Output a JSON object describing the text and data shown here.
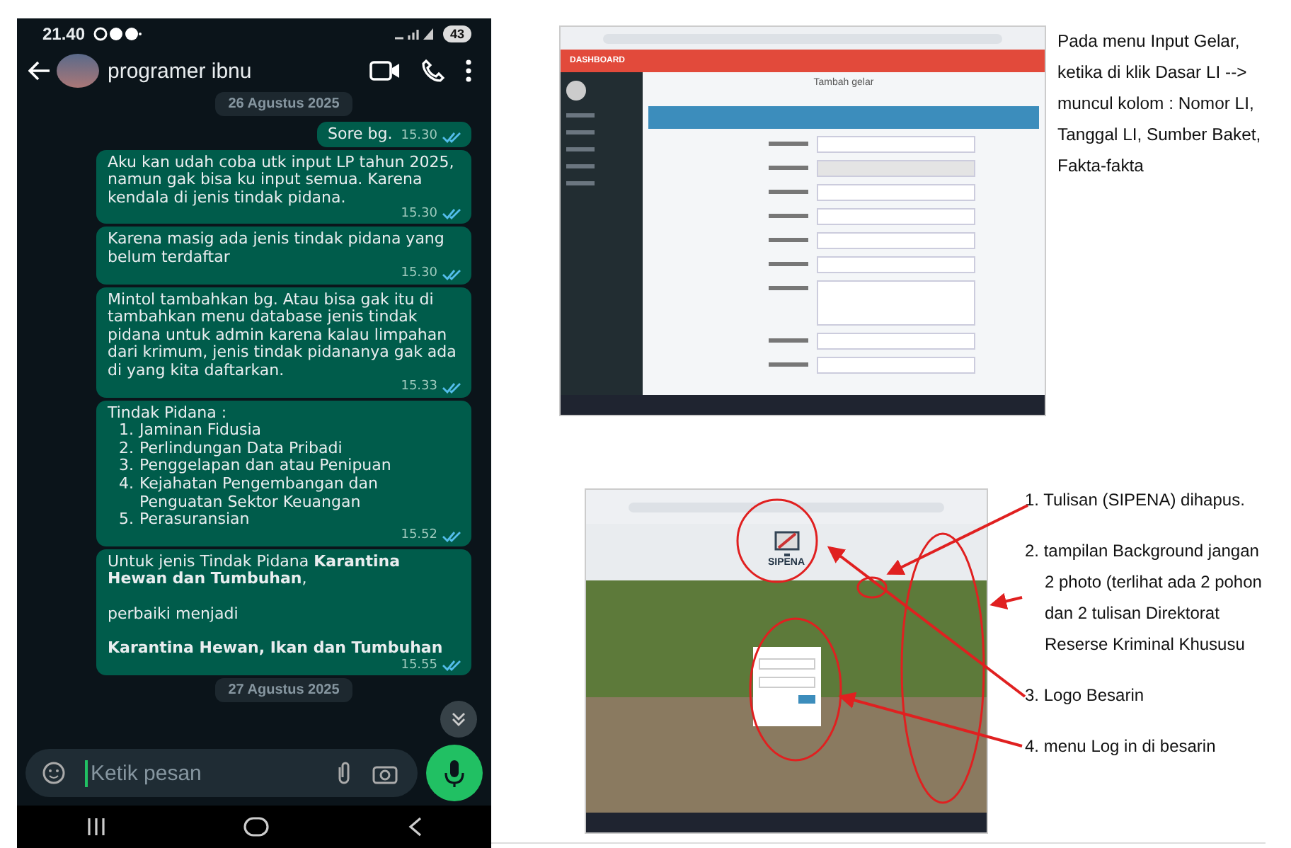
{
  "phone": {
    "status_bar": {
      "time": "21.40",
      "battery": "43"
    },
    "chat_header": {
      "contact_name": "programer ibnu"
    },
    "messages": [
      {
        "kind": "date",
        "text": "26 Agustus 2025"
      },
      {
        "kind": "text",
        "text": "Sore bg.",
        "time": "15.30",
        "read": true
      },
      {
        "kind": "text",
        "text": "Aku kan udah coba utk input LP tahun 2025, namun gak bisa ku input semua. Karena kendala di jenis tindak pidana.",
        "time": "15.30",
        "read": true
      },
      {
        "kind": "text",
        "text": "Karena masig ada jenis tindak pidana yang belum terdaftar",
        "time": "15.30",
        "read": true
      },
      {
        "kind": "text",
        "text": "Mintol tambahkan bg. Atau bisa gak itu di tambahkan menu database jenis tindak pidana untuk admin karena kalau limpahan dari krimum, jenis tindak pidananya gak ada di yang kita daftarkan.",
        "time": "15.33",
        "read": true
      },
      {
        "kind": "list",
        "heading": "Tindak Pidana :",
        "items": [
          {
            "number": "1.",
            "text": "Jaminan Fidusia"
          },
          {
            "number": "2.",
            "text": "Perlindungan Data Pribadi"
          },
          {
            "number": "3.",
            "text": "Penggelapan dan atau Penipuan"
          },
          {
            "number": "4.",
            "text": "Kejahatan Pengembangan dan Penguatan Sektor Keuangan"
          },
          {
            "number": "5.",
            "text": "Perasuransian"
          }
        ],
        "time": "15.52",
        "read": true
      },
      {
        "kind": "paragraphs",
        "paragraphs": [
          {
            "text": "Untuk jenis Tindak Pidana **Karantina Hewan dan Tumbuhan**,",
            "bold": false
          },
          {
            "text": "perbaiki menjadi",
            "bold": false
          },
          {
            "text": "Karantina Hewan, Ikan dan Tumbuhan",
            "bold": true
          }
        ],
        "time": "15.55",
        "read": true
      },
      {
        "kind": "date",
        "text": "27 Agustus 2025"
      }
    ],
    "composer": {
      "placeholder": "Ketik pesan"
    }
  },
  "document": {
    "screenshot_1": {
      "brand": "DASHBOARD",
      "page_title": "Tambah gelar",
      "caption": "Pada menu Input Gelar, ketika di klik Dasar LI --> muncul kolom : Nomor LI, Tanggal LI, Sumber Baket, Fakta-fakta"
    },
    "screenshot_2": {
      "logo_text": "SIPENA",
      "notes": [
        "1. Tulisan (SIPENA) dihapus.",
        "2. tampilan Background jangan 2 photo (terlihat ada 2 pohon dan 2 tulisan Direktorat Reserse Kriminal Khususu",
        "3. Logo Besarin",
        "4. menu Log in di besarin"
      ]
    }
  }
}
